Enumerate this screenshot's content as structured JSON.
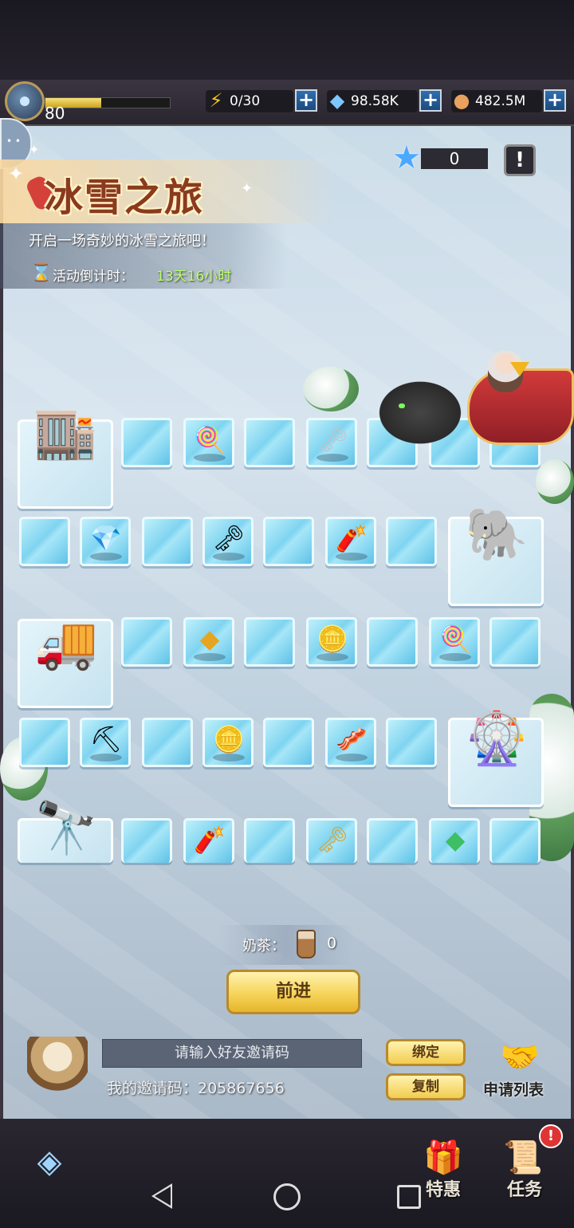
{
  "player": {
    "level": "80",
    "xp_progress": 0.45
  },
  "resources": [
    {
      "name": "energy",
      "icon": "lightning-icon",
      "value": "0/30"
    },
    {
      "name": "diamonds",
      "icon": "diamond-icon",
      "value": "98.58K"
    },
    {
      "name": "coins",
      "icon": "coin-icon",
      "value": "482.5M"
    }
  ],
  "event": {
    "title": "冰雪之旅",
    "subtitle": "开启一场奇妙的冰雪之旅吧！",
    "countdown_label": "活动倒计时：",
    "countdown_value": "13天16小时",
    "star_count": "0",
    "help": "!"
  },
  "board_items": {
    "row1": [
      "candy",
      "key"
    ],
    "row2": [
      "diamond",
      "key",
      "dynamite-box"
    ],
    "row3": [
      "gold-gem",
      "coin",
      "candy"
    ],
    "row4": [
      "pickaxe",
      "coin",
      "bacon"
    ],
    "row5": [
      "dynamite-box",
      "key",
      "green-gem"
    ]
  },
  "milk_tea": {
    "label": "奶茶：",
    "count": "0"
  },
  "buttons": {
    "go": "前进",
    "bind": "绑定",
    "copy": "复制"
  },
  "invite": {
    "placeholder": "请输入好友邀请码",
    "my_code_label": "我的邀请码：205867656"
  },
  "apply_list": {
    "label": "申请列表"
  },
  "nav": {
    "special": "特惠",
    "tasks": "任务",
    "tasks_badge": "!"
  }
}
